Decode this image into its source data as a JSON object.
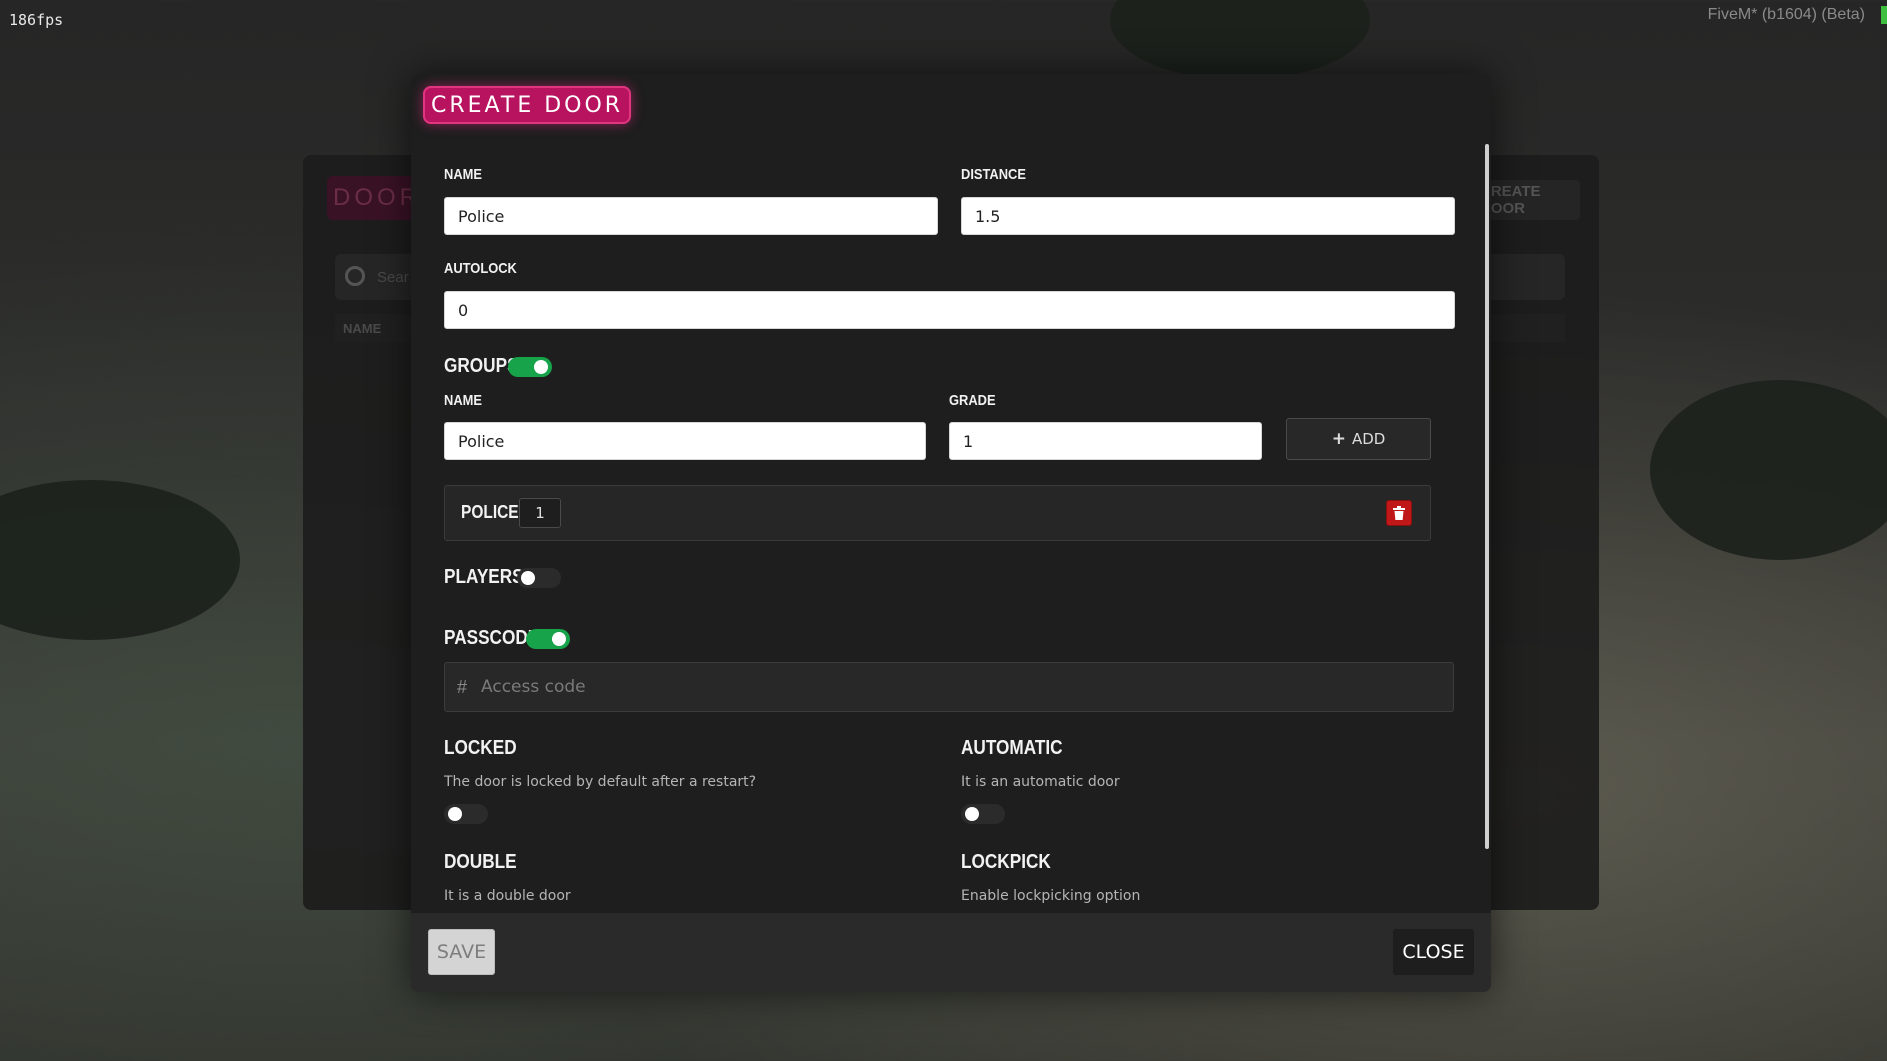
{
  "hud": {
    "fps": "186fps",
    "client_version": "FiveM* (b1604) (Beta)"
  },
  "background_panel": {
    "title": "DOOR",
    "create_button": "CREATE DOOR",
    "search_placeholder": "Sear",
    "name_column": "NAME"
  },
  "modal": {
    "title": "CREATE DOOR",
    "name_label": "NAME",
    "name_value": "Police",
    "distance_label": "DISTANCE",
    "distance_value": "1.5",
    "autolock_label": "AUTOLOCK",
    "autolock_value": "0",
    "groups": {
      "label": "GROUPS",
      "enabled": true,
      "name_label": "NAME",
      "name_value": "Police",
      "grade_label": "GRADE",
      "grade_value": "1",
      "add_button": "ADD",
      "items": [
        {
          "name": "POLICE",
          "grade": "1"
        }
      ]
    },
    "players": {
      "label": "PLAYERS",
      "enabled": false
    },
    "passcode": {
      "label": "PASSCODE",
      "enabled": true,
      "placeholder": "Access code",
      "icon": "#"
    },
    "locked": {
      "label": "LOCKED",
      "description": "The door is locked by default after a restart?",
      "enabled": false
    },
    "automatic": {
      "label": "AUTOMATIC",
      "description": "It is an automatic door",
      "enabled": false
    },
    "double": {
      "label": "DOUBLE",
      "description": "It is a double door"
    },
    "lockpick": {
      "label": "LOCKPICK",
      "description": "Enable lockpicking option"
    },
    "footer": {
      "save_button": "SAVE",
      "close_button": "CLOSE"
    }
  },
  "colors": {
    "accent_pink": "#b8135f",
    "toggle_on": "#17a34a",
    "danger_red": "#c01818"
  }
}
